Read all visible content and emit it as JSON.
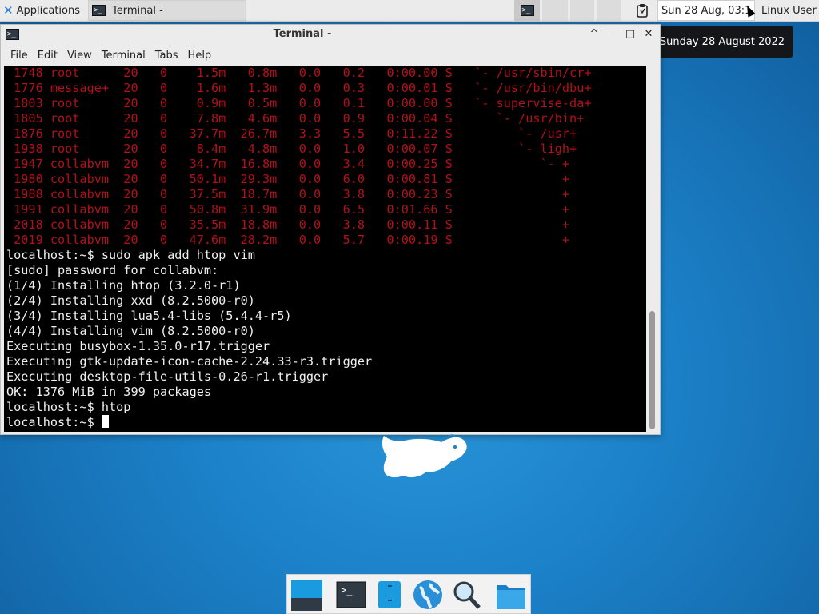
{
  "top_panel": {
    "applications_label": "Applications",
    "task_terminal_label": "Terminal -",
    "clock_text": "Sun 28 Aug, 03:1",
    "user_label": "Linux User",
    "tooltip_text": "Sunday 28 August 2022"
  },
  "window": {
    "title": "Terminal -",
    "controls": {
      "minimize": "–",
      "up": "^",
      "maximize": "□",
      "close": "✕"
    },
    "menu": [
      "File",
      "Edit",
      "View",
      "Terminal",
      "Tabs",
      "Help"
    ]
  },
  "terminal": {
    "htop_rows": [
      " 1748 root      20   0    1.5m   0.8m   0.0   0.2   0:00.00 S   `- /usr/sbin/cr+",
      " 1776 message+  20   0    1.6m   1.3m   0.0   0.3   0:00.01 S   `- /usr/bin/dbu+",
      " 1803 root      20   0    0.9m   0.5m   0.0   0.1   0:00.00 S   `- supervise-da+",
      " 1805 root      20   0    7.8m   4.6m   0.0   0.9   0:00.04 S      `- /usr/bin+",
      " 1876 root      20   0   37.7m  26.7m   3.3   5.5   0:11.22 S         `- /usr+",
      " 1938 root      20   0    8.4m   4.8m   0.0   1.0   0:00.07 S         `- ligh+",
      " 1947 collabvm  20   0   34.7m  16.8m   0.0   3.4   0:00.25 S            `- +",
      " 1980 collabvm  20   0   50.1m  29.3m   0.0   6.0   0:00.81 S               +",
      " 1988 collabvm  20   0   37.5m  18.7m   0.0   3.8   0:00.23 S               +",
      " 1991 collabvm  20   0   50.8m  31.9m   0.0   6.5   0:01.66 S               +",
      " 2018 collabvm  20   0   35.5m  18.8m   0.0   3.8   0:00.11 S               +",
      " 2019 collabvm  20   0   47.6m  28.2m   0.0   5.7   0:00.19 S               +"
    ],
    "output_lines": [
      "localhost:~$ sudo apk add htop vim",
      "[sudo] password for collabvm:",
      "(1/4) Installing htop (3.2.0-r1)",
      "(2/4) Installing xxd (8.2.5000-r0)",
      "(3/4) Installing lua5.4-libs (5.4.4-r5)",
      "(4/4) Installing vim (8.2.5000-r0)",
      "Executing busybox-1.35.0-r17.trigger",
      "Executing gtk-update-icon-cache-2.24.33-r3.trigger",
      "Executing desktop-file-utils-0.26-r1.trigger",
      "OK: 1376 MiB in 399 packages",
      "localhost:~$ htop"
    ],
    "prompt": "localhost:~$ "
  },
  "dock": {
    "items": [
      "show-desktop",
      "terminal",
      "file-manager",
      "web-browser",
      "app-finder",
      "home-folder"
    ]
  },
  "colors": {
    "htop_text": "#b3101a",
    "terminal_bg": "#000000",
    "desktop_bg": "#1d84cc"
  }
}
